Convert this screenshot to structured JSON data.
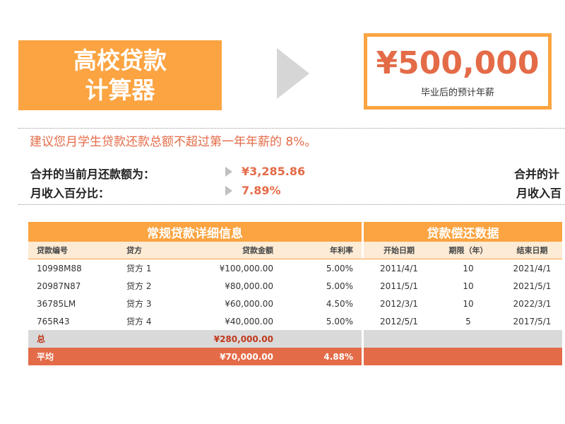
{
  "header": {
    "title_line1": "高校贷款",
    "title_line2": "计算器",
    "salary_value": "¥500,000",
    "salary_label": "毕业后的预计年薪"
  },
  "advice": "建议您月学生贷款还款总额不超过第一年年薪的 8%。",
  "summary": {
    "monthly_label": "合并的当前月还款额为：",
    "monthly_value": "¥3,285.86",
    "percent_label": "月收入百分比：",
    "percent_value": "7.89%",
    "right_label1": "合并的计",
    "right_label2": "月收入百"
  },
  "table": {
    "section1_title": "常规贷款详细信息",
    "section2_title": "贷款偿还数据",
    "columns": [
      "贷款编号",
      "贷方",
      "贷款金额",
      "年利率",
      "开始日期",
      "期限（年）",
      "结束日期"
    ],
    "rows": [
      [
        "10998M88",
        "贷方 1",
        "¥100,000.00",
        "5.00%",
        "2011/4/1",
        "10",
        "2021/4/1"
      ],
      [
        "20987N87",
        "贷方 2",
        "¥80,000.00",
        "5.00%",
        "2011/5/1",
        "10",
        "2021/5/1"
      ],
      [
        "36785LM",
        "贷方 3",
        "¥60,000.00",
        "4.50%",
        "2012/3/1",
        "10",
        "2022/3/1"
      ],
      [
        "765R43",
        "贷方 4",
        "¥40,000.00",
        "5.00%",
        "2012/5/1",
        "5",
        "2017/5/1"
      ]
    ],
    "total_label": "总",
    "total_amount": "¥280,000.00",
    "avg_label": "平均",
    "avg_amount": "¥70,000.00",
    "avg_rate": "4.88%"
  },
  "colors": {
    "orange": "#fba441",
    "coral": "#e46b48",
    "light_orange": "#fdebd5",
    "gray": "#d9d9d9"
  }
}
